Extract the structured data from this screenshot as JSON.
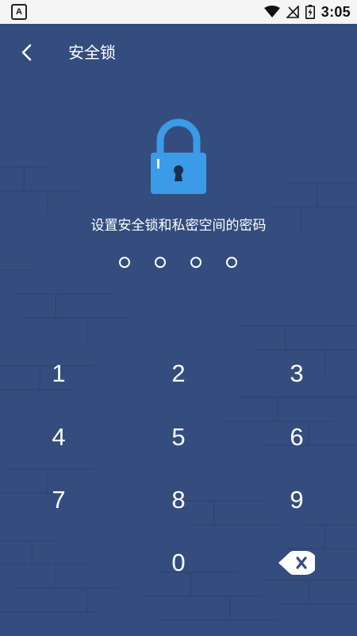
{
  "status_bar": {
    "app_badge": "A",
    "time": "3:05",
    "icons": [
      "wifi-icon",
      "signal-icon",
      "battery-charging-icon"
    ]
  },
  "header": {
    "title": "安全锁",
    "back_icon": "chevron-left-icon"
  },
  "lock": {
    "icon": "padlock-icon",
    "prompt": "设置安全锁和私密空间的密码"
  },
  "pin": {
    "length": 4,
    "filled": 0
  },
  "keypad": {
    "keys": [
      "1",
      "2",
      "3",
      "4",
      "5",
      "6",
      "7",
      "8",
      "9",
      "0"
    ],
    "delete_icon": "backspace-icon"
  },
  "colors": {
    "background": "#344d7e",
    "lock_blue": "#3b9be6",
    "status_bar": "#f5f5f5"
  }
}
